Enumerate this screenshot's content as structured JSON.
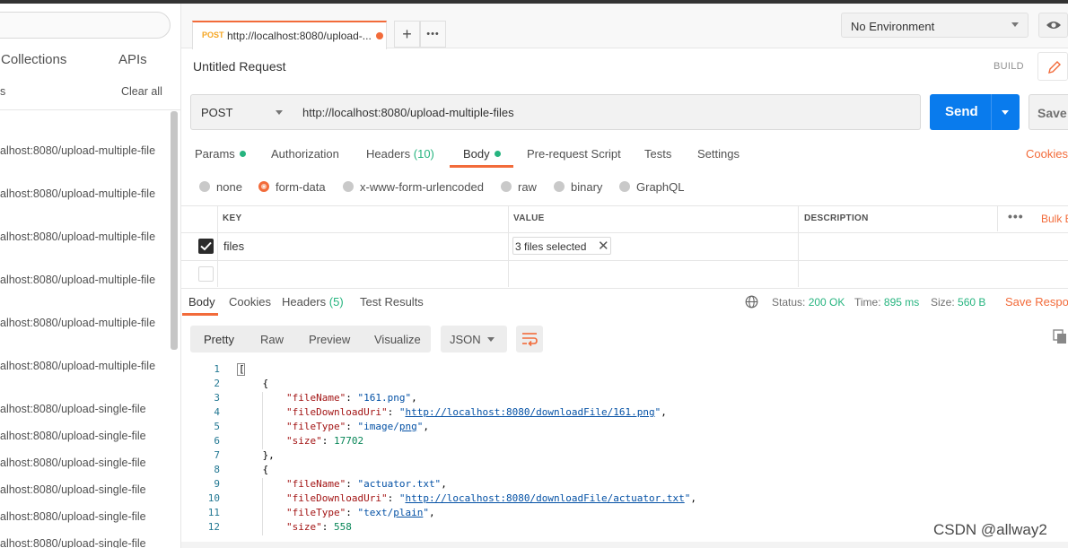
{
  "sidebar": {
    "tabs": [
      "Collections",
      "APIs"
    ],
    "history_partial": "s",
    "clear_all": "Clear all",
    "items": [
      "alhost:8080/upload-multiple-file",
      "alhost:8080/upload-multiple-file",
      "alhost:8080/upload-multiple-file",
      "alhost:8080/upload-multiple-file",
      "alhost:8080/upload-multiple-file",
      "alhost:8080/upload-multiple-file",
      "alhost:8080/upload-single-file",
      "alhost:8080/upload-single-file",
      "alhost:8080/upload-single-file",
      "alhost:8080/upload-single-file",
      "alhost:8080/upload-single-file",
      "alhost:8080/upload-single-file"
    ]
  },
  "tabstrip": {
    "tab_method": "POST",
    "tab_url": "http://localhost:8080/upload-...",
    "add_label": "+",
    "more_label": "•••",
    "environment": "No Environment"
  },
  "request": {
    "title": "Untitled Request",
    "build_label": "BUILD",
    "method": "POST",
    "url": "http://localhost:8080/upload-multiple-files",
    "send_label": "Send",
    "save_label": "Save",
    "tabs": {
      "params": "Params",
      "authorization": "Authorization",
      "headers": "Headers",
      "headers_count": "(10)",
      "body": "Body",
      "prerequest": "Pre-request Script",
      "tests": "Tests",
      "settings": "Settings"
    },
    "cookies_link": "Cookies",
    "body_types": [
      "none",
      "form-data",
      "x-www-form-urlencoded",
      "raw",
      "binary",
      "GraphQL"
    ],
    "selected_body_type": "form-data",
    "table": {
      "headers": [
        "KEY",
        "VALUE",
        "DESCRIPTION"
      ],
      "bulk_edit": "Bulk E",
      "rows": [
        {
          "checked": true,
          "key": "files",
          "value": "3 files selected"
        }
      ]
    }
  },
  "response": {
    "tabs": {
      "body": "Body",
      "cookies": "Cookies",
      "headers": "Headers",
      "headers_count": "(5)",
      "test_results": "Test Results"
    },
    "status_label": "Status:",
    "status_value": "200 OK",
    "time_label": "Time:",
    "time_value": "895 ms",
    "size_label": "Size:",
    "size_value": "560 B",
    "save_response": "Save Respor",
    "views": [
      "Pretty",
      "Raw",
      "Preview",
      "Visualize"
    ],
    "format": "JSON",
    "code_lines": [
      {
        "n": "1"
      },
      {
        "n": "2"
      },
      {
        "n": "3"
      },
      {
        "n": "4"
      },
      {
        "n": "5"
      },
      {
        "n": "6"
      },
      {
        "n": "7"
      },
      {
        "n": "8"
      },
      {
        "n": "9"
      },
      {
        "n": "10"
      },
      {
        "n": "11"
      },
      {
        "n": "12"
      }
    ],
    "json": {
      "open_bracket": "[",
      "open_brace": "{",
      "close_brace_comma": "},",
      "k_fileName": "\"fileName\"",
      "k_fileDownloadUri": "\"fileDownloadUri\"",
      "k_fileType": "\"fileType\"",
      "k_size": "\"size\"",
      "v1_fileName": "\"161.png\"",
      "v1_uri": "http://localhost:8080/downloadFile/161.png",
      "v1_type_a": "\"image/",
      "v1_type_b": "png",
      "v1_size": "17702",
      "v2_fileName": "\"actuator.txt\"",
      "v2_uri": "http://localhost:8080/downloadFile/actuator.txt",
      "v2_type_a": "\"text/",
      "v2_type_b": "plain",
      "v2_size": "558"
    }
  },
  "watermark": "CSDN @allway2"
}
